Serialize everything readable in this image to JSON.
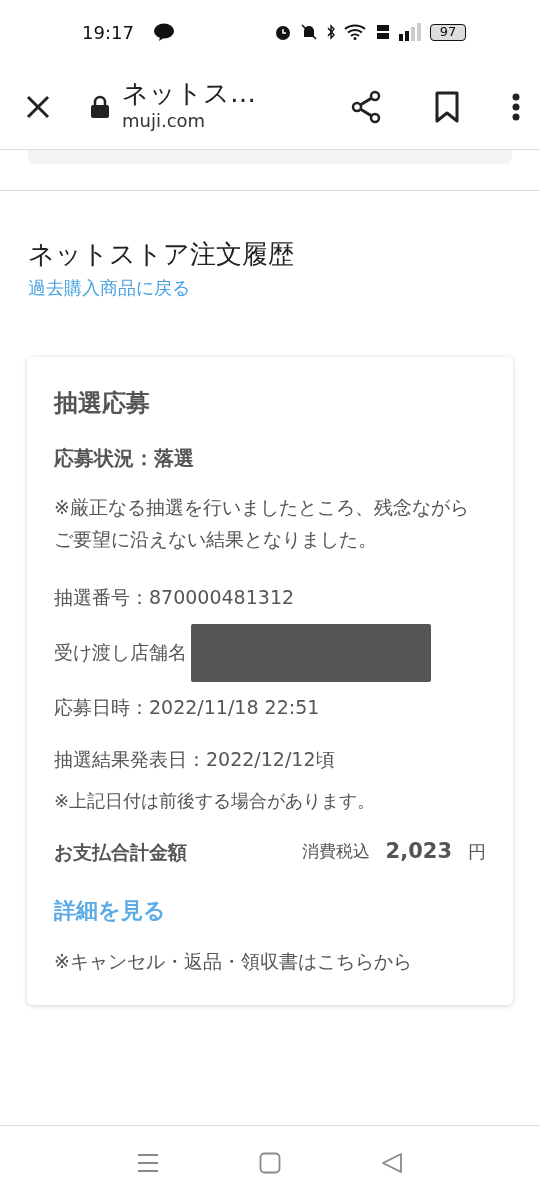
{
  "status_bar": {
    "time": "19:17",
    "battery": "97"
  },
  "browser_toolbar": {
    "title": "ネットス…",
    "url": "muji.com"
  },
  "page": {
    "heading": "ネットストア注文履歴",
    "back_link": "過去購入商品に戻る"
  },
  "lottery_card": {
    "title": "抽選応募",
    "status": "応募状況：落選",
    "message": "※厳正なる抽選を行いましたところ、残念ながらご要望に沿えない結果となりました。",
    "fields": [
      {
        "label": "抽選番号：870000481312",
        "redacted": false
      },
      {
        "label": "受け渡し店舗名",
        "redacted": true
      },
      {
        "label": "応募日時：2022/11/18 22:51",
        "redacted": false
      },
      {
        "label": "抽選結果発表日：2022/12/12頃",
        "redacted": false
      }
    ],
    "date_note": "※上記日付は前後する場合があります。",
    "total": {
      "label": "お支払合計金額",
      "tax_note": "消費税込",
      "amount": "2,023",
      "currency": "円"
    },
    "details_link": "詳細を見る",
    "cancel_note": "※キャンセル・返品・領収書はこちらから"
  }
}
